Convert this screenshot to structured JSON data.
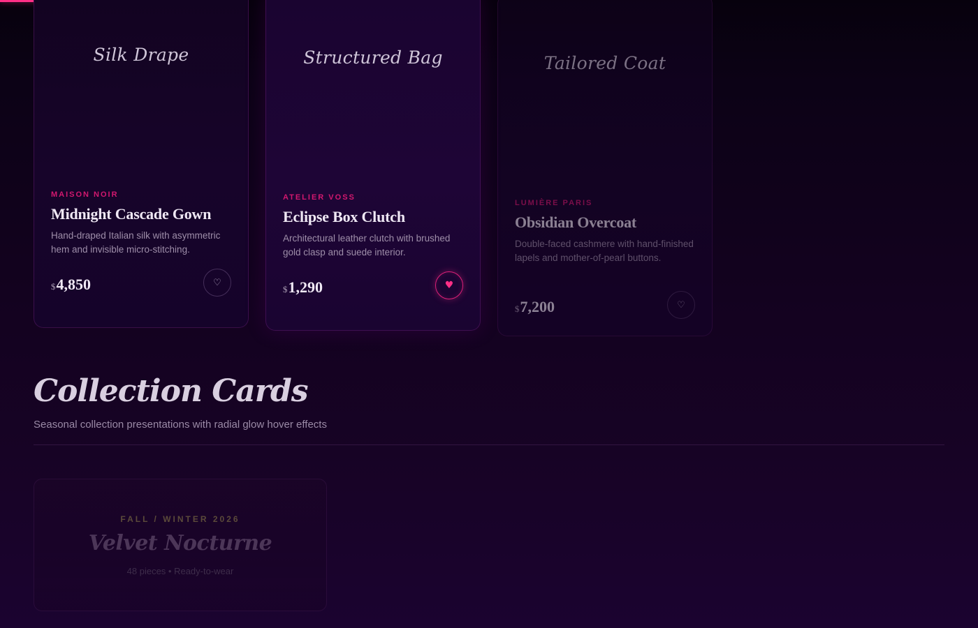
{
  "products": [
    {
      "media_title": "Silk Drape",
      "brand": "MAISON NOIR",
      "name": "Midnight Cascade Gown",
      "description": "Hand-draped Italian silk with asymmetric hem and invisible micro-stitching.",
      "currency": "$",
      "price": "4,850",
      "favorite": false,
      "heart_icon": "heart-outline-icon"
    },
    {
      "media_title": "Structured Bag",
      "brand": "ATELIER VOSS",
      "name": "Eclipse Box Clutch",
      "description": "Architectural leather clutch with brushed gold clasp and suede interior.",
      "currency": "$",
      "price": "1,290",
      "favorite": true,
      "heart_icon": "heart-filled-icon"
    },
    {
      "media_title": "Tailored Coat",
      "brand": "LUMIÈRE PARIS",
      "name": "Obsidian Overcoat",
      "description": "Double-faced cashmere with hand-finished lapels and mother-of-pearl buttons.",
      "currency": "$",
      "price": "7,200",
      "favorite": false,
      "heart_icon": "heart-outline-icon"
    }
  ],
  "section": {
    "title": "Collection Cards",
    "subtitle": "Seasonal collection presentations with radial glow hover effects"
  },
  "collections": [
    {
      "season": "FALL / WINTER 2026",
      "title": "Velvet Nocturne",
      "meta": "48 pieces • Ready-to-wear"
    }
  ],
  "colors": {
    "accent": "#ff2f86",
    "brand_label": "#d2186f",
    "background": "#13021f"
  },
  "scroll_progress": 0.16
}
